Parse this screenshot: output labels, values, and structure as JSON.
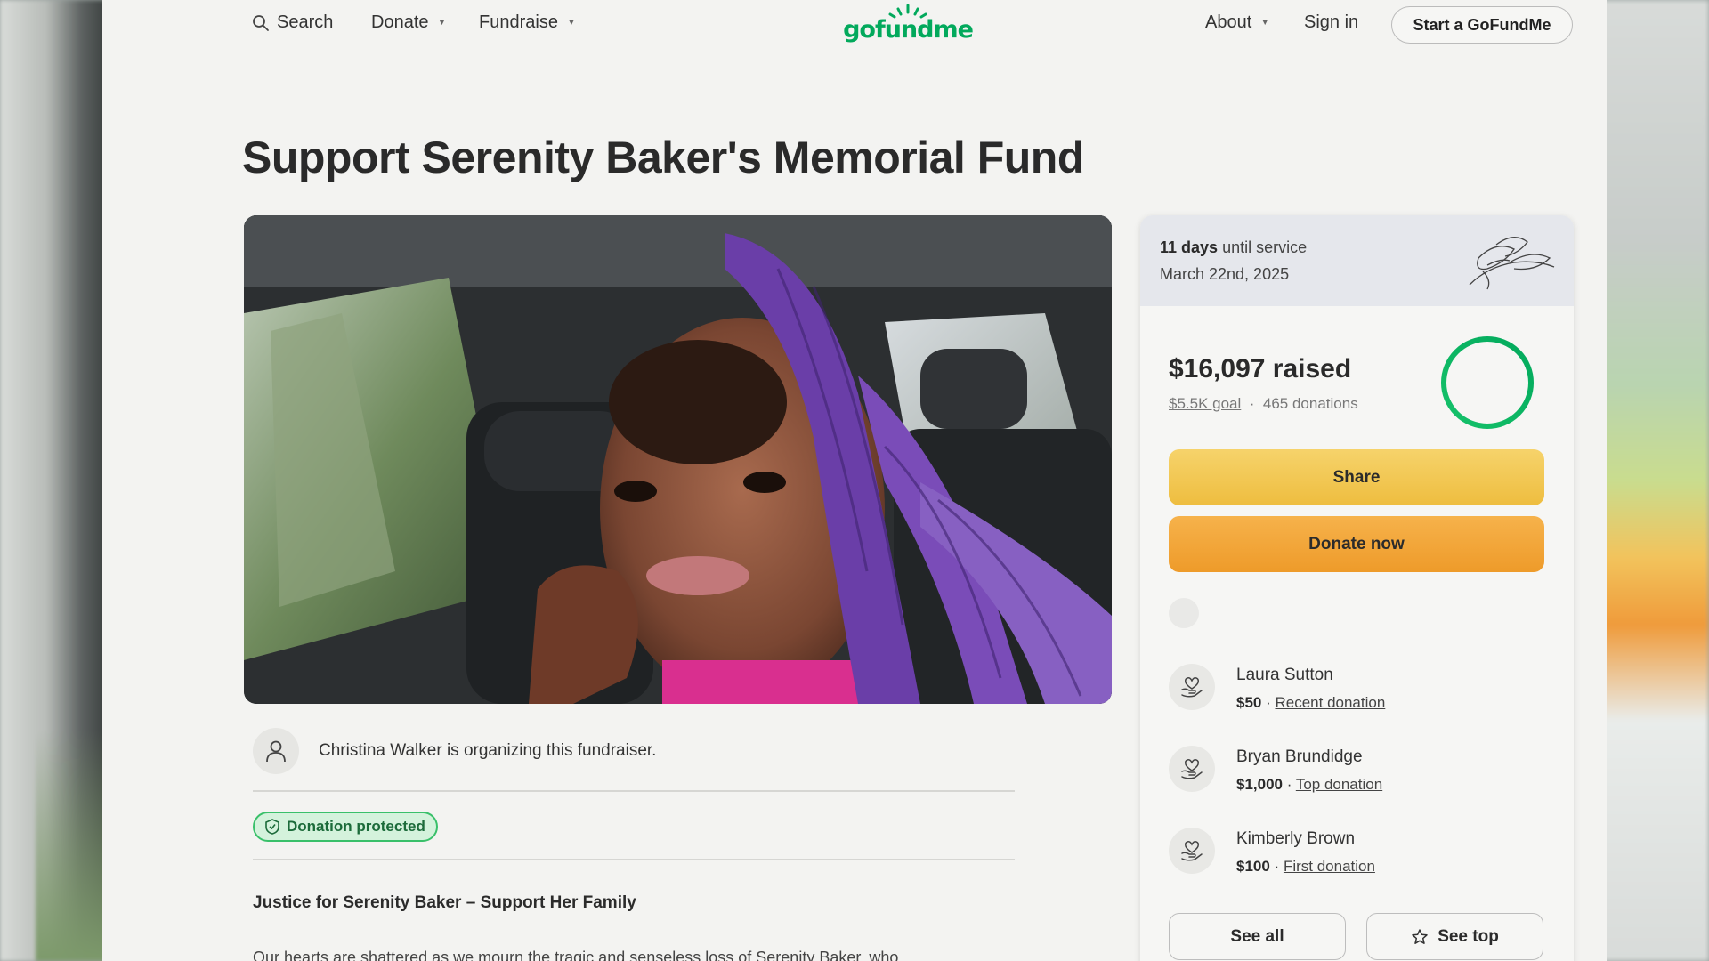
{
  "nav": {
    "search_label": "Search",
    "donate_label": "Donate",
    "fundraise_label": "Fundraise",
    "logo_text": "gofundme",
    "about_label": "About",
    "signin_label": "Sign in",
    "start_label": "Start a GoFundMe"
  },
  "campaign": {
    "title": "Support Serenity Baker's Memorial Fund",
    "organizer_text": "Christina Walker is organizing this fundraiser.",
    "badge_label": "Donation protected",
    "story_heading": "Justice for Serenity Baker – Support Her Family",
    "story_text": "Our hearts are shattered as we mourn the tragic and senseless loss of Serenity Baker, who"
  },
  "card": {
    "service_days": "11 days",
    "service_suffix": " until service",
    "service_date": "March 22nd, 2025",
    "raised": "$16,097 raised",
    "goal": "$5.5K goal",
    "donations": "465 donations",
    "progress_fraction": 1.0,
    "share_label": "Share",
    "donate_label": "Donate now",
    "donors": [
      {
        "name": "Laura Sutton",
        "amount": "$50",
        "tag": "Recent donation"
      },
      {
        "name": "Bryan Brundidge",
        "amount": "$1,000",
        "tag": "Top donation"
      },
      {
        "name": "Kimberly Brown",
        "amount": "$100",
        "tag": "First donation"
      }
    ],
    "see_all_label": "See all",
    "see_top_label": "See top"
  },
  "colors": {
    "brand_green": "#02a95c",
    "share_yellow": "#eebd3f",
    "donate_orange": "#ee9b2a",
    "badge_green": "#39c06a"
  }
}
